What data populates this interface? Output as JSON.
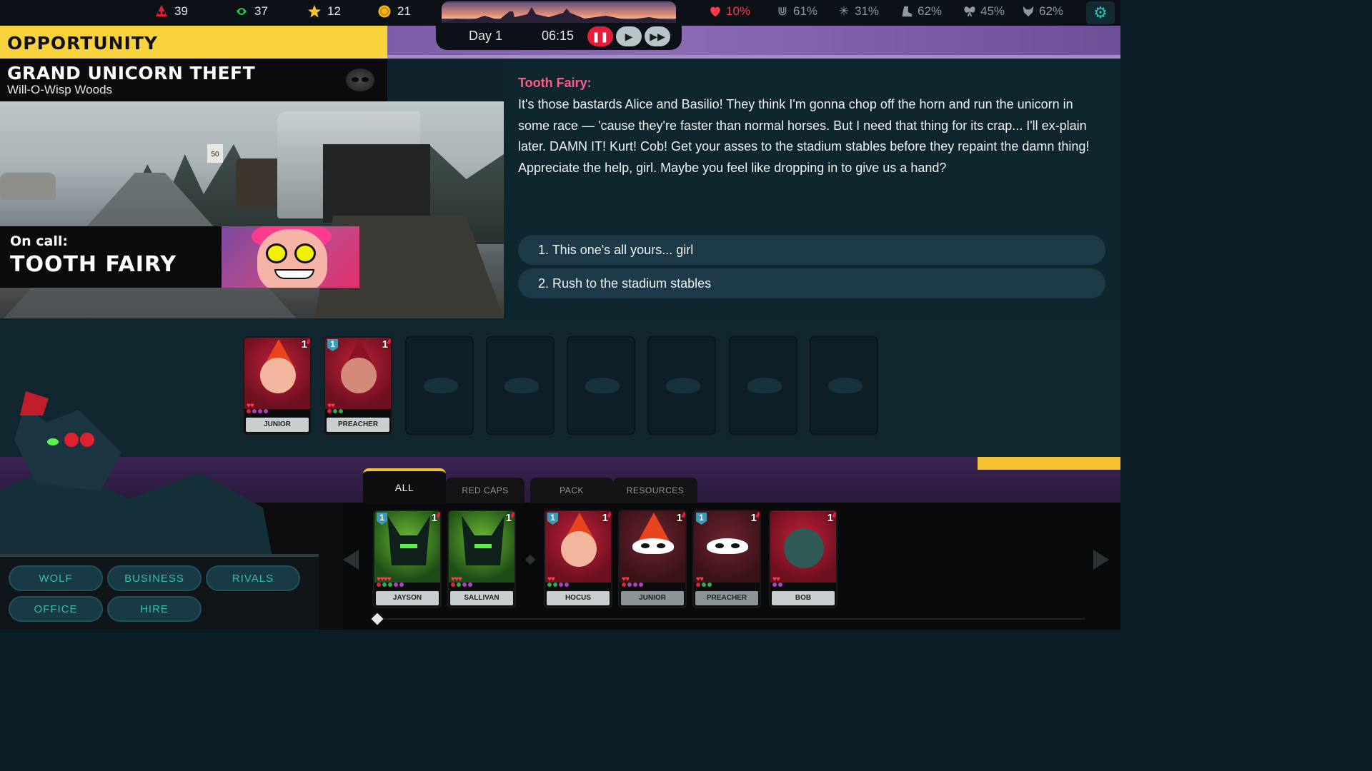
{
  "resources": [
    {
      "icon": "red-cap-icon",
      "value": "39"
    },
    {
      "icon": "green-gem-icon",
      "value": "37"
    },
    {
      "icon": "star-icon",
      "value": "12"
    },
    {
      "icon": "gold-coin-icon",
      "value": "21"
    }
  ],
  "stats": [
    {
      "icon": "heart-shield-icon",
      "value": "10%"
    },
    {
      "icon": "horseshoe-icon",
      "value": "61%"
    },
    {
      "icon": "snowflake-icon",
      "value": "31%"
    },
    {
      "icon": "boot-icon",
      "value": "62%"
    },
    {
      "icon": "butterfly-icon",
      "value": "45%"
    },
    {
      "icon": "fox-icon",
      "value": "62%"
    }
  ],
  "clock": {
    "day": "Day 1",
    "time": "06:15"
  },
  "mission": {
    "banner": "OPPORTUNITY",
    "title": "GRAND UNICORN THEFT",
    "location": "Will-O-Wisp Woods",
    "sign": "50",
    "oncall_label": "On call:",
    "oncall_name": "TOOTH FAIRY"
  },
  "dialog": {
    "speaker": "Tooth Fairy:",
    "text": "It's those bastards Alice and Basilio! They think I'm gonna chop off the horn and run the unicorn in some race — 'cause they're faster than normal horses. But I need that thing for its crap... I'll ex-plain later. DAMN IT! Kurt! Cob! Get your asses to the stadium stables before they repaint the damn thing! Appreciate the help, girl. Maybe you feel like dropping in to give us a hand?",
    "choices": [
      "1. This one's all yours... girl",
      "2. Rush to the stadium stables"
    ]
  },
  "crew_slots": [
    {
      "name": "JUNIOR",
      "rank": "1",
      "level": "",
      "hearts": "♥♥",
      "pips": [
        "#e0204a",
        "#b040c0",
        "#b040c0",
        "#b040c0"
      ]
    },
    {
      "name": "PREACHER",
      "rank": "1",
      "level": "1",
      "hearts": "♥♥",
      "pips": [
        "#e0204a",
        "#2ab050",
        "#2ab050"
      ]
    }
  ],
  "empty_slots": 6,
  "nav_buttons": [
    "WOLF",
    "BUSINESS",
    "RIVALS",
    "OFFICE",
    "HIRE"
  ],
  "tabs": [
    "ALL",
    "RED CAPS",
    "PACK",
    "RESOURCES"
  ],
  "roster": [
    {
      "name": "JAYSON",
      "level": "1",
      "rank": "1",
      "hearts": "♥♥♥♥",
      "type": "wolf"
    },
    {
      "name": "SALLIVAN",
      "level": "",
      "rank": "1",
      "hearts": "♥♥♥",
      "type": "wolf"
    },
    {
      "name": "HOCUS",
      "level": "1",
      "rank": "1",
      "hearts": "♥♥",
      "type": "gnome"
    },
    {
      "name": "JUNIOR",
      "level": "",
      "rank": "1",
      "hearts": "♥♥",
      "type": "masked"
    },
    {
      "name": "PREACHER",
      "level": "1",
      "rank": "1",
      "hearts": "♥♥",
      "type": "masked"
    },
    {
      "name": "BOB",
      "level": "",
      "rank": "1",
      "hearts": "♥♥",
      "type": "hood"
    }
  ],
  "colors": {
    "accent_yellow": "#f9d33e",
    "speaker_pink": "#ff5c8a",
    "alert_red": "#ff3b4a",
    "teal": "#33bdb4"
  }
}
